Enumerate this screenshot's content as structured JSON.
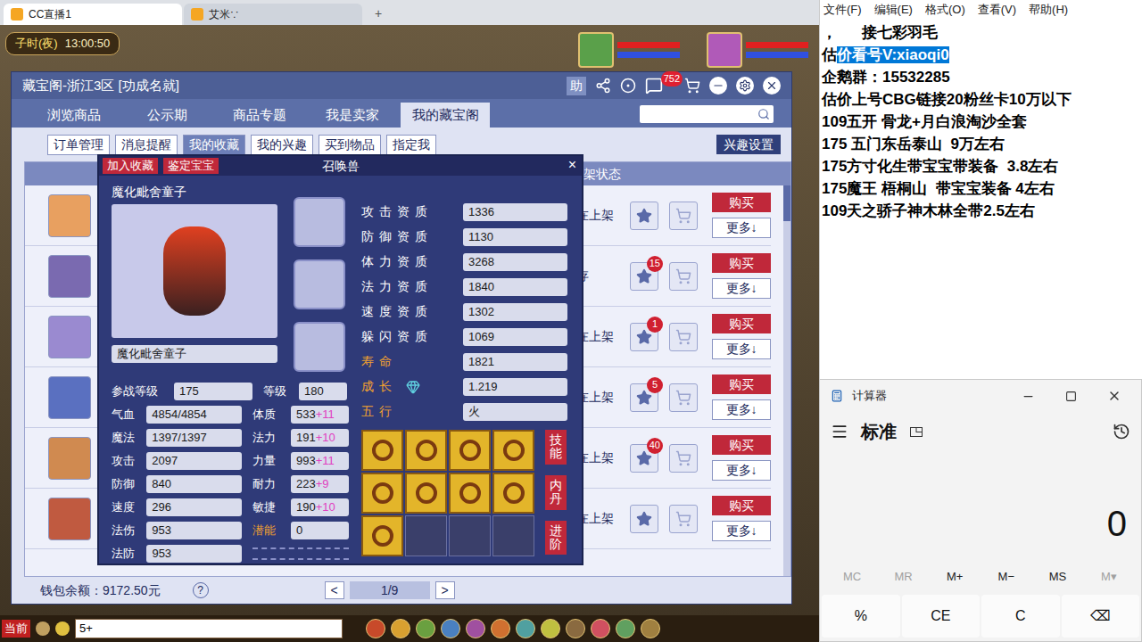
{
  "browser": {
    "tabs": [
      {
        "label": "CC直播1",
        "selected": true
      },
      {
        "label": "艾米∵",
        "selected": false
      }
    ],
    "new_tab": "+"
  },
  "game": {
    "hud": {
      "period": "子时(夜)",
      "time": "13:00:50",
      "portraits": [
        {
          "color": "#5aa04a",
          "hp_level": 1,
          "mp_level": 1
        },
        {
          "color": "#b05ab8",
          "hp_level": 1,
          "mp_level": 1
        }
      ]
    },
    "bottom_bar": {
      "channel": "当前",
      "chat_input": "5+"
    }
  },
  "cbg_window": {
    "title": "藏宝阁-浙江3区 [功成名就]",
    "help_button": "助",
    "message_badge": "752",
    "tabs": [
      {
        "label": "浏览商品",
        "selected": false
      },
      {
        "label": "公示期",
        "selected": false
      },
      {
        "label": "商品专题",
        "selected": false
      },
      {
        "label": "我是卖家",
        "selected": false
      },
      {
        "label": "我的藏宝阁",
        "selected": true
      }
    ],
    "subtabs": [
      {
        "label": "订单管理",
        "selected": false
      },
      {
        "label": "消息提醒",
        "selected": false
      },
      {
        "label": "我的收藏",
        "selected": true
      },
      {
        "label": "我的兴趣",
        "selected": false
      },
      {
        "label": "买到物品",
        "selected": false
      },
      {
        "label": "指定我",
        "selected": false
      }
    ],
    "interest_button": "兴趣设置",
    "list_header": "架状态",
    "row_actions": {
      "buy": "购买",
      "more": "更多↓"
    },
    "rows": [
      {
        "status": "在上架",
        "badge": "",
        "color": "#e8a060"
      },
      {
        "status": "存",
        "badge": "15",
        "color": "#7a6ab0"
      },
      {
        "status": "在上架",
        "badge": "1",
        "color": "#9a8ad0"
      },
      {
        "status": "在上架",
        "badge": "5",
        "color": "#5a70c0"
      },
      {
        "status": "在上架",
        "badge": "40",
        "color": "#d08a50"
      },
      {
        "status": "在上架",
        "badge": "",
        "color": "#c05a40"
      }
    ],
    "wallet": "钱包余额：9172.50元",
    "help": "?",
    "pager": {
      "prev": "<",
      "page": "1/9",
      "next": ">"
    }
  },
  "pet_dialog": {
    "buttons": [
      "加入收藏",
      "鉴定宝宝"
    ],
    "title": "召唤兽",
    "close": "×",
    "name": "魔化毗舍童子",
    "name_field": "魔化毗舍童子",
    "levels": [
      {
        "label": "参战等级",
        "value": "175"
      },
      {
        "label": "等级",
        "value": "180"
      }
    ],
    "left_stats": [
      {
        "label": "气血",
        "value": "4854/4854"
      },
      {
        "label": "魔法",
        "value": "1397/1397"
      },
      {
        "label": "攻击",
        "value": "2097"
      },
      {
        "label": "防御",
        "value": "840"
      },
      {
        "label": "速度",
        "value": "296"
      },
      {
        "label": "法伤",
        "value": "953"
      },
      {
        "label": "法防",
        "value": "953"
      }
    ],
    "right_stats": [
      {
        "label": "体质",
        "value": "533",
        "bonus": "+11",
        "color": "#ffffff"
      },
      {
        "label": "法力",
        "value": "191",
        "bonus": "+10",
        "color": "#ffffff"
      },
      {
        "label": "力量",
        "value": "993",
        "bonus": "+11",
        "color": "#ffffff"
      },
      {
        "label": "耐力",
        "value": "223",
        "bonus": "+9",
        "color": "#ffffff"
      },
      {
        "label": "敏捷",
        "value": "190",
        "bonus": "+10",
        "color": "#ffffff"
      },
      {
        "label": "潜能",
        "value": "0",
        "bonus": "",
        "color": "#f0a030"
      }
    ],
    "aptitudes": [
      {
        "label": "攻击资质",
        "value": "1336",
        "color": "#ffffff"
      },
      {
        "label": "防御资质",
        "value": "1130",
        "color": "#ffffff"
      },
      {
        "label": "体力资质",
        "value": "3268",
        "color": "#ffffff"
      },
      {
        "label": "法力资质",
        "value": "1840",
        "color": "#ffffff"
      },
      {
        "label": "速度资质",
        "value": "1302",
        "color": "#ffffff"
      },
      {
        "label": "躲闪资质",
        "value": "1069",
        "color": "#ffffff"
      },
      {
        "label": "寿命",
        "value": "1821",
        "color": "#f0a030"
      },
      {
        "label": "成长",
        "value": "1.219",
        "color": "#f0a030"
      },
      {
        "label": "五行",
        "value": "火",
        "color": "#f0a030"
      }
    ],
    "skills": [
      {
        "filled": true
      },
      {
        "filled": true
      },
      {
        "filled": true
      },
      {
        "filled": true
      },
      {
        "filled": true
      },
      {
        "filled": true
      },
      {
        "filled": true
      },
      {
        "filled": true
      },
      {
        "filled": true
      },
      {
        "filled": false
      },
      {
        "filled": false
      },
      {
        "filled": false
      }
    ],
    "side_buttons": [
      "技能",
      "内丹",
      "进阶"
    ]
  },
  "notepad": {
    "menu": [
      "文件(F)",
      "编辑(E)",
      "格式(O)",
      "查看(V)",
      "帮助(H)"
    ],
    "lines": [
      [
        {
          "text": "，      接七彩羽毛",
          "selected": false
        }
      ],
      [
        {
          "text": "估",
          "selected": false
        },
        {
          "text": "价看号V:xiaoqi0",
          "selected": true
        }
      ],
      [
        {
          "text": "企鹅群：15532285",
          "selected": false
        }
      ],
      [
        {
          "text": "估价上号CBG链接20粉丝卡10万以下",
          "selected": false
        }
      ],
      [
        {
          "text": "109五开 骨龙+月白浪淘沙全套",
          "selected": false
        }
      ],
      [
        {
          "text": "175 五门东岳泰山  9万左右",
          "selected": false
        }
      ],
      [
        {
          "text": "175方寸化生带宝宝带装备  3.8左右",
          "selected": false
        }
      ],
      [
        {
          "text": "175魔王 梧桐山  带宝宝装备 4左右",
          "selected": false
        }
      ],
      [
        {
          "text": "109天之骄子神木林全带2.5左右",
          "selected": false
        }
      ]
    ]
  },
  "calculator": {
    "title": "计算器",
    "mode": "标准",
    "display": "0",
    "memory": [
      {
        "label": "MC",
        "disabled": true
      },
      {
        "label": "MR",
        "disabled": true
      },
      {
        "label": "M+",
        "disabled": false
      },
      {
        "label": "M−",
        "disabled": false
      },
      {
        "label": "MS",
        "disabled": false
      },
      {
        "label": "M▾",
        "disabled": true
      }
    ],
    "keys": [
      "%",
      "CE",
      "C",
      "⌫"
    ]
  }
}
